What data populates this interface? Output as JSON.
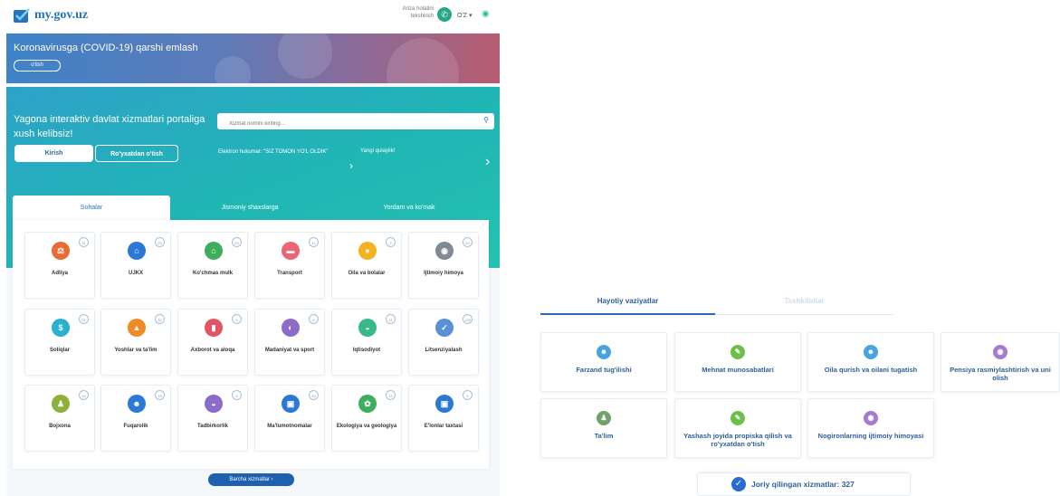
{
  "header": {
    "logo_text": "my.gov.uz",
    "status_check": "Ariza holatini tekshirish",
    "language": "O'Z",
    "colors": {
      "brand": "#2573b8",
      "phone": "#24a88b"
    }
  },
  "covid_banner": {
    "title": "Koronavirusga (COVID-19) qarshi emlash",
    "button": "o'tish"
  },
  "hero": {
    "title": "Yagona interaktiv davlat xizmatlari portaliga xush kelibsiz!",
    "login_button": "Kirish",
    "register_button": "Ro'yxatdan o'tish",
    "search_placeholder": "Xizmat nomini kiriting...",
    "news": [
      "Elektron hukumat: \"SIZ TOMON YO'L OLDIK\"",
      "Yangi qulaylik!"
    ]
  },
  "tabs": [
    "Sohalar",
    "Jismoniy shaxslarga",
    "Yordam va ko'mak"
  ],
  "categories": [
    {
      "label": "Adliya",
      "count": "11",
      "icon": "scales-icon",
      "color": "#e86a35"
    },
    {
      "label": "UJKX",
      "count": "25",
      "icon": "utilities-icon",
      "color": "#2a79d6"
    },
    {
      "label": "Ko'chmas mulk",
      "count": "20",
      "icon": "house-icon",
      "color": "#3fae5c"
    },
    {
      "label": "Transport",
      "count": "11",
      "icon": "car-icon",
      "color": "#ef6474"
    },
    {
      "label": "Oila va bolalar",
      "count": "2",
      "icon": "family-icon",
      "color": "#f3b21f"
    },
    {
      "label": "Ijtimoiy himoya",
      "count": "10",
      "icon": "shield-icon",
      "color": "#7f8a96"
    },
    {
      "label": "Soliqlar",
      "count": "21",
      "icon": "tax-icon",
      "color": "#2ab0d0"
    },
    {
      "label": "Yoshlar va ta'lim",
      "count": "32",
      "icon": "graduation-cap-icon",
      "color": "#f08a24"
    },
    {
      "label": "Axborot va aloqa",
      "count": "3",
      "icon": "document-icon",
      "color": "#e25563"
    },
    {
      "label": "Madaniyat va sport",
      "count": "6",
      "icon": "mask-icon",
      "color": "#8b6dc9"
    },
    {
      "label": "Iqtisodiyot",
      "count": "11",
      "icon": "handshake-icon",
      "color": "#39b889"
    },
    {
      "label": "Litsenziyalash",
      "count": "133",
      "icon": "license-icon",
      "color": "#5b8fd6"
    },
    {
      "label": "Bojxona",
      "count": "20",
      "icon": "customs-officer-icon",
      "color": "#90b03c"
    },
    {
      "label": "Fuqarolik",
      "count": "15",
      "icon": "citizen-icon",
      "color": "#2a79d6"
    },
    {
      "label": "Tadbirkorlik",
      "count": "5",
      "icon": "handshake-icon",
      "color": "#8b6dc9"
    },
    {
      "label": "Ma'lumotnomalar",
      "count": "33",
      "icon": "id-card-icon",
      "color": "#2a79d6"
    },
    {
      "label": "Ekologiya va geologiya",
      "count": "12",
      "icon": "leaf-icon",
      "color": "#3fae5c"
    },
    {
      "label": "E'lonlar taxtasi",
      "count": "5",
      "icon": "board-icon",
      "color": "#2a79d6"
    }
  ],
  "all_services_button": "Barcha xizmatlar ›",
  "life_situations": {
    "tabs": [
      "Hayotiy vaziyatlar",
      "Tashkilotlar"
    ],
    "items": [
      {
        "label": "Farzand tug'ilishi",
        "icon": "baby-icon",
        "color": "#4aa3df"
      },
      {
        "label": "Mehnat munosabatlari",
        "icon": "contract-icon",
        "color": "#6cc04a"
      },
      {
        "label": "Oila qurish va oilani tugatish",
        "icon": "baby-icon",
        "color": "#4aa3df"
      },
      {
        "label": "Pensiya rasmiylashtirish va uni olish",
        "icon": "shield-icon",
        "color": "#a57ad0"
      },
      {
        "label": "Ta'lim",
        "icon": "student-icon",
        "color": "#6fa36b"
      },
      {
        "label": "Yashash joyida propiska qilish va ro'yxatdan o'tish",
        "icon": "contract-icon",
        "color": "#6cc04a"
      },
      {
        "label": "Nogironlarning ijtimoiy himoyasi",
        "icon": "shield-icon",
        "color": "#a57ad0"
      }
    ],
    "counter_label": "Joriy qilingan xizmatlar:",
    "counter_value": "327"
  }
}
